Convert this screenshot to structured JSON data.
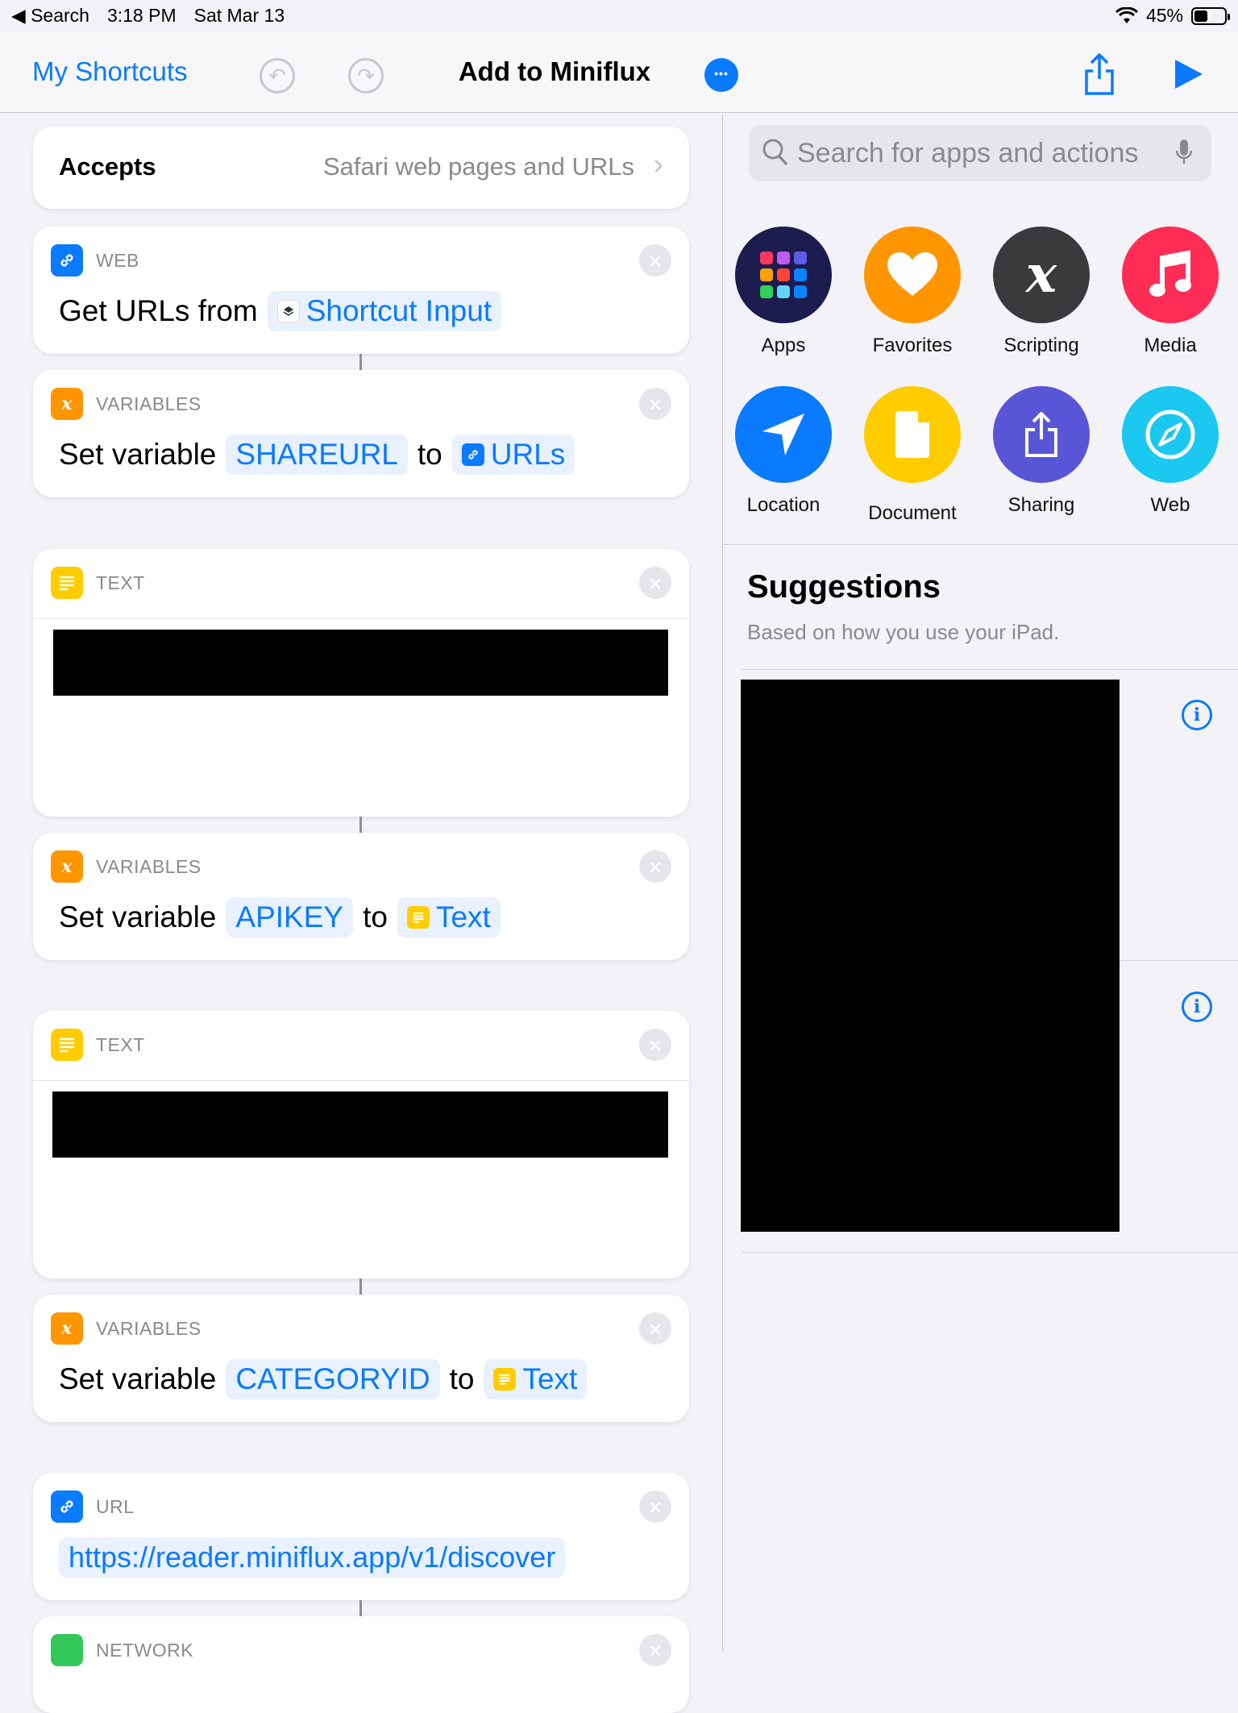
{
  "status_bar": {
    "back_app": "◀ Search",
    "time": "3:18 PM",
    "date": "Sat Mar 13",
    "battery": "45%",
    "battery_level": 0.45
  },
  "nav": {
    "back_label": "My Shortcuts",
    "title": "Add to Miniflux",
    "more_glyph": "•••"
  },
  "accepts": {
    "label": "Accepts",
    "value": "Safari web pages and URLs",
    "chevron": "›"
  },
  "actions": [
    {
      "category": "WEB",
      "icon": "link-icon",
      "verb": "Get URLs from",
      "token": "Shortcut Input",
      "token_icon": "shortcuts-icon"
    },
    {
      "category": "VARIABLES",
      "icon": "variable-icon",
      "verb": "Set variable",
      "name": "SHAREURL",
      "to": "to",
      "token": "URLs",
      "token_icon": "link-icon"
    },
    {
      "category": "TEXT",
      "icon": "text-icon"
    },
    {
      "category": "VARIABLES",
      "icon": "variable-icon",
      "verb": "Set variable",
      "name": "APIKEY",
      "to": "to",
      "token": "Text",
      "token_icon": "text-icon"
    },
    {
      "category": "TEXT",
      "icon": "text-icon"
    },
    {
      "category": "VARIABLES",
      "icon": "variable-icon",
      "verb": "Set variable",
      "name": "CATEGORYID",
      "to": "to",
      "token": "Text",
      "token_icon": "text-icon"
    },
    {
      "category": "URL",
      "icon": "link-icon",
      "url": "https://reader.miniflux.app/v1/discover"
    },
    {
      "category": "NETWORK",
      "icon": "network-icon"
    }
  ],
  "variable_glyph": "x",
  "close_glyph": "✕",
  "search": {
    "placeholder": "Search for apps and actions"
  },
  "categories": [
    {
      "label": "Apps",
      "icon": "apps-grid-icon",
      "color": "#1c1c4e"
    },
    {
      "label": "Favorites",
      "icon": "heart-icon",
      "color": "#ff9500"
    },
    {
      "label": "Scripting",
      "icon": "scripting-x-icon",
      "color": "#3a3a3c",
      "glyph": "x"
    },
    {
      "label": "Media",
      "icon": "music-note-icon",
      "color": "#ff2d55"
    },
    {
      "label": "Location",
      "icon": "location-arrow-icon",
      "color": "#0a7aff"
    },
    {
      "label": "Document",
      "icon": "document-icon",
      "color": "#ffcc00"
    },
    {
      "label": "Sharing",
      "icon": "share-icon",
      "color": "#5856d6"
    },
    {
      "label": "Web",
      "icon": "compass-icon",
      "color": "#1ac8f0"
    }
  ],
  "suggestions": {
    "title": "Suggestions",
    "subtitle": "Based on how you use your iPad.",
    "info_glyph": "i"
  },
  "colors": {
    "accent": "#0a7aff",
    "background": "#f2f2f7"
  }
}
